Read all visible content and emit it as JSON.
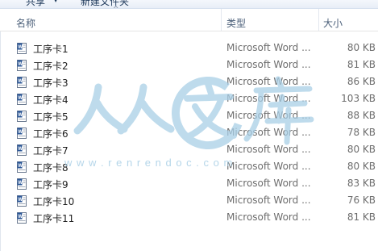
{
  "toolbar": {
    "share_label": "共享",
    "share_arrow": "▼",
    "new_folder_label": "新建文件夹"
  },
  "columns": {
    "name": "名称",
    "type": "类型",
    "size": "大小",
    "sort_indicator": "^"
  },
  "files": [
    {
      "name": "工序卡1",
      "type": "Microsoft Word ...",
      "size": "80 KB",
      "icon": "word-doc-icon"
    },
    {
      "name": "工序卡2",
      "type": "Microsoft Word ...",
      "size": "81 KB",
      "icon": "word-doc-icon"
    },
    {
      "name": "工序卡3",
      "type": "Microsoft Word ...",
      "size": "86 KB",
      "icon": "word-doc-icon"
    },
    {
      "name": "工序卡4",
      "type": "Microsoft Word ...",
      "size": "103 KB",
      "icon": "word-doc-icon"
    },
    {
      "name": "工序卡5",
      "type": "Microsoft Word ...",
      "size": "88 KB",
      "icon": "word-doc-icon"
    },
    {
      "name": "工序卡6",
      "type": "Microsoft Word ...",
      "size": "78 KB",
      "icon": "word-doc-icon"
    },
    {
      "name": "工序卡7",
      "type": "Microsoft Word ...",
      "size": "80 KB",
      "icon": "word-doc-icon"
    },
    {
      "name": "工序卡8",
      "type": "Microsoft Word ...",
      "size": "80 KB",
      "icon": "word-doc-icon"
    },
    {
      "name": "工序卡9",
      "type": "Microsoft Word ...",
      "size": "83 KB",
      "icon": "word-doc-icon"
    },
    {
      "name": "工序卡10",
      "type": "Microsoft Word ...",
      "size": "76 KB",
      "icon": "word-doc-icon"
    },
    {
      "name": "工序卡11",
      "type": "Microsoft Word ...",
      "size": "81 KB",
      "icon": "word-doc-icon"
    }
  ],
  "watermark": {
    "chars": "人人文库",
    "url": "w w w . r e n r e n d o c . c o m",
    "color": "#a9cfe6"
  }
}
